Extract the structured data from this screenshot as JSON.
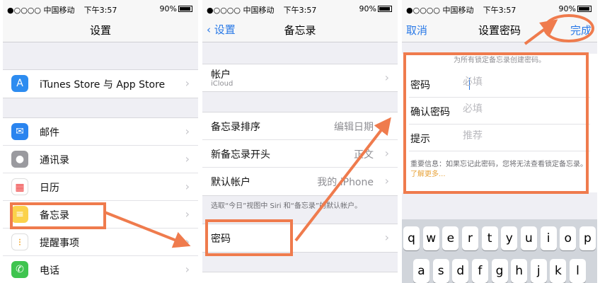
{
  "status": {
    "carrier": "●○○○○ 中国移动",
    "time": "下午3:57",
    "battery": "90%"
  },
  "settings": {
    "title": "设置",
    "items": [
      {
        "label": "iTunes Store 与 App Store",
        "icon": "app-store-icon",
        "color": "#2d8cf0"
      },
      {
        "label": "邮件",
        "icon": "mail-icon",
        "color": "#2a84ef"
      },
      {
        "label": "通讯录",
        "icon": "contacts-icon",
        "color": "#9a9a9f"
      },
      {
        "label": "日历",
        "icon": "calendar-icon",
        "color": "#ffffff"
      },
      {
        "label": "备忘录",
        "icon": "notes-icon",
        "color": "#fbd24b"
      },
      {
        "label": "提醒事项",
        "icon": "reminders-icon",
        "color": "#ffffff"
      },
      {
        "label": "电话",
        "icon": "phone-icon",
        "color": "#3fc44f"
      }
    ]
  },
  "notes": {
    "back": "设置",
    "title": "备忘录",
    "account": {
      "label": "帐户",
      "sub": "iCloud"
    },
    "sort": {
      "label": "备忘录排序",
      "value": "编辑日期"
    },
    "new_start": {
      "label": "新备忘录开头",
      "value": "正文"
    },
    "default_account": {
      "label": "默认帐户",
      "value": "我的 iPhone"
    },
    "default_note": "选取“今日”视图中 Siri 和“备忘录”的默认帐户。",
    "password": {
      "label": "密码"
    }
  },
  "set_password": {
    "cancel": "取消",
    "title": "设置密码",
    "done": "完成",
    "top_hint": "为所有锁定备忘录创建密码。",
    "password_label": "密码",
    "password_placeholder": "必填",
    "confirm_label": "确认密码",
    "confirm_placeholder": "必填",
    "hint_label": "提示",
    "hint_placeholder": "推荐",
    "important": "重要信息：如果忘记此密码，您将无法查看锁定备忘录。",
    "learn_more": "了解更多..."
  },
  "keyboard": {
    "row1": [
      "q",
      "w",
      "e",
      "r",
      "t",
      "y",
      "u",
      "i",
      "o",
      "p"
    ],
    "row2": [
      "a",
      "s",
      "d",
      "f",
      "g",
      "h",
      "j",
      "k",
      "l"
    ]
  },
  "colors": {
    "accent": "#2979e7",
    "highlight": "#ef7b4d"
  }
}
